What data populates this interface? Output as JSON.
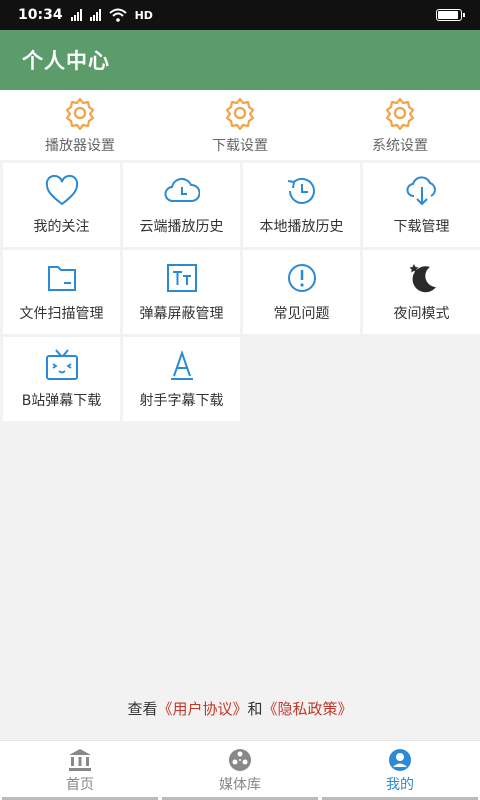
{
  "status_bar": {
    "time": "10:34",
    "network": "HD"
  },
  "app_bar": {
    "title": "个人中心"
  },
  "settings": [
    {
      "label": "播放器设置",
      "icon": "gear-icon"
    },
    {
      "label": "下载设置",
      "icon": "gear-icon"
    },
    {
      "label": "系统设置",
      "icon": "gear-icon"
    }
  ],
  "grid": [
    {
      "label": "我的关注",
      "icon": "heart-icon"
    },
    {
      "label": "云端播放历史",
      "icon": "cloud-clock-icon"
    },
    {
      "label": "本地播放历史",
      "icon": "history-clock-icon"
    },
    {
      "label": "下载管理",
      "icon": "cloud-download-icon"
    },
    {
      "label": "文件扫描管理",
      "icon": "folder-icon"
    },
    {
      "label": "弹幕屏蔽管理",
      "icon": "text-size-icon"
    },
    {
      "label": "常见问题",
      "icon": "exclamation-icon"
    },
    {
      "label": "夜间模式",
      "icon": "moon-stars-icon"
    },
    {
      "label": "B站弹幕下载",
      "icon": "tv-icon"
    },
    {
      "label": "射手字幕下载",
      "icon": "letter-a-icon"
    }
  ],
  "agreement": {
    "prefix": "查看",
    "user_agreement": "《用户协议》",
    "conjunction": "和",
    "privacy_policy": "《隐私政策》"
  },
  "bottom_nav": [
    {
      "label": "首页",
      "icon": "bank-icon",
      "active": false
    },
    {
      "label": "媒体库",
      "icon": "film-reel-icon",
      "active": false
    },
    {
      "label": "我的",
      "icon": "user-circle-icon",
      "active": true
    }
  ],
  "colors": {
    "primary_green": "#5b9c6a",
    "icon_blue": "#2b8ad6",
    "gear_orange": "#f0a34a",
    "link_red": "#c0392b"
  }
}
